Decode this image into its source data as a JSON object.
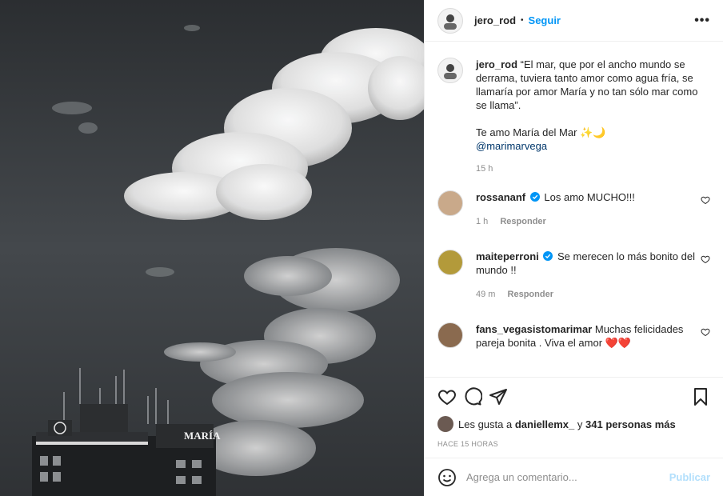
{
  "post": {
    "author": "jero_rod",
    "follow_label": "Seguir",
    "separator": "•",
    "more_label": "•••"
  },
  "caption": {
    "user": "jero_rod",
    "text_1": "“El mar, que por el ancho mundo se derrama, tuviera tanto amor como agua fría, se llamaría por amor María y no tan sólo mar como se llama”.",
    "text_2": "Te amo María del Mar ✨🌙",
    "mention": "@marimarvega",
    "time": "15 h"
  },
  "comments": [
    {
      "user": "rossananf",
      "verified": true,
      "text": "Los amo MUCHO!!!",
      "time": "1 h",
      "reply": "Responder"
    },
    {
      "user": "maiteperroni",
      "verified": true,
      "text": "Se merecen lo más bonito del mundo !!",
      "time": "49 m",
      "reply": "Responder"
    },
    {
      "user": "fans_vegasistomarimar",
      "verified": false,
      "text": "Muchas felicidades pareja bonita . Viva el amor ❤️❤️",
      "time": "",
      "reply": ""
    }
  ],
  "likes": {
    "prefix": "Les gusta a",
    "user": "daniellemx_",
    "middle": "y",
    "count_text": "341 personas más"
  },
  "timestamp": "HACE 15 HORAS",
  "composer": {
    "placeholder": "Agrega un comentario...",
    "publish_label": "Publicar"
  },
  "photo": {
    "sign_text": "MARÍA"
  },
  "colors": {
    "accent": "#0095f6",
    "publish_disabled": "#b2dffc",
    "heart": "#ed4956",
    "muted": "#8e8e8e"
  }
}
